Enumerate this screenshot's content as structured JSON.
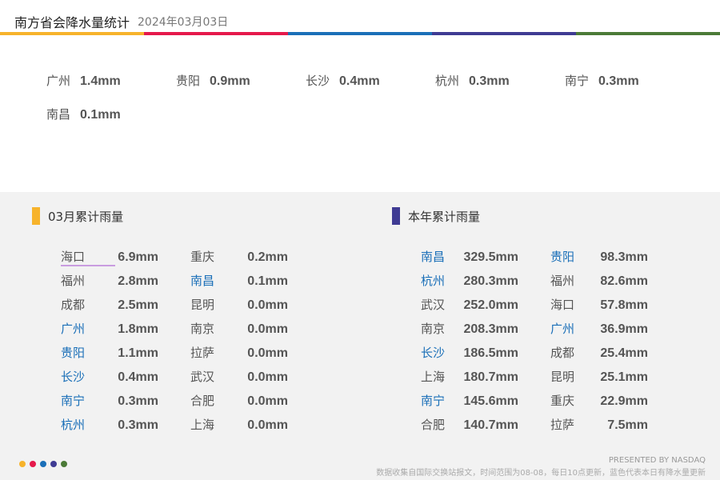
{
  "header": {
    "title": "南方省会降水量统计",
    "date": "2024年03月03日"
  },
  "colors": {
    "bar": [
      "#f7b32b",
      "#e5194b",
      "#1a6fb8",
      "#3f3b93",
      "#4b7a37"
    ],
    "highlight": "#1a6fb8"
  },
  "today": [
    {
      "city": "广州",
      "value": "1.4mm"
    },
    {
      "city": "贵阳",
      "value": "0.9mm"
    },
    {
      "city": "长沙",
      "value": "0.4mm"
    },
    {
      "city": "杭州",
      "value": "0.3mm"
    },
    {
      "city": "南宁",
      "value": "0.3mm"
    },
    {
      "city": "南昌",
      "value": "0.1mm"
    }
  ],
  "monthly": {
    "title": "03月累计雨量",
    "rows": [
      {
        "city": "海口",
        "value": "6.9mm",
        "hl": false
      },
      {
        "city": "福州",
        "value": "2.8mm",
        "hl": false
      },
      {
        "city": "成都",
        "value": "2.5mm",
        "hl": false
      },
      {
        "city": "广州",
        "value": "1.8mm",
        "hl": true
      },
      {
        "city": "贵阳",
        "value": "1.1mm",
        "hl": true
      },
      {
        "city": "长沙",
        "value": "0.4mm",
        "hl": true
      },
      {
        "city": "南宁",
        "value": "0.3mm",
        "hl": true
      },
      {
        "city": "杭州",
        "value": "0.3mm",
        "hl": true
      },
      {
        "city": "重庆",
        "value": "0.2mm",
        "hl": false
      },
      {
        "city": "南昌",
        "value": "0.1mm",
        "hl": true
      },
      {
        "city": "昆明",
        "value": "0.0mm",
        "hl": false
      },
      {
        "city": "南京",
        "value": "0.0mm",
        "hl": false
      },
      {
        "city": "拉萨",
        "value": "0.0mm",
        "hl": false
      },
      {
        "city": "武汉",
        "value": "0.0mm",
        "hl": false
      },
      {
        "city": "合肥",
        "value": "0.0mm",
        "hl": false
      },
      {
        "city": "上海",
        "value": "0.0mm",
        "hl": false
      }
    ]
  },
  "yearly": {
    "title": "本年累计雨量",
    "rows": [
      {
        "city": "南昌",
        "value": "329.5mm",
        "hl": true
      },
      {
        "city": "杭州",
        "value": "280.3mm",
        "hl": true
      },
      {
        "city": "武汉",
        "value": "252.0mm",
        "hl": false
      },
      {
        "city": "南京",
        "value": "208.3mm",
        "hl": false
      },
      {
        "city": "长沙",
        "value": "186.5mm",
        "hl": true
      },
      {
        "city": "上海",
        "value": "180.7mm",
        "hl": false
      },
      {
        "city": "南宁",
        "value": "145.6mm",
        "hl": true
      },
      {
        "city": "合肥",
        "value": "140.7mm",
        "hl": false
      },
      {
        "city": "贵阳",
        "value": "98.3mm",
        "hl": true
      },
      {
        "city": "福州",
        "value": "82.6mm",
        "hl": false
      },
      {
        "city": "海口",
        "value": "57.8mm",
        "hl": false
      },
      {
        "city": "广州",
        "value": "36.9mm",
        "hl": true
      },
      {
        "city": "成都",
        "value": "25.4mm",
        "hl": false
      },
      {
        "city": "昆明",
        "value": "25.1mm",
        "hl": false
      },
      {
        "city": "重庆",
        "value": "22.9mm",
        "hl": false
      },
      {
        "city": "拉萨",
        "value": "7.5mm",
        "hl": false
      }
    ]
  },
  "footer": {
    "presented": "PRESENTED BY NASDAQ",
    "note": "数据收集自国际交换站报文，时间范围为08-08，每日10点更新，蓝色代表本日有降水量更新"
  }
}
